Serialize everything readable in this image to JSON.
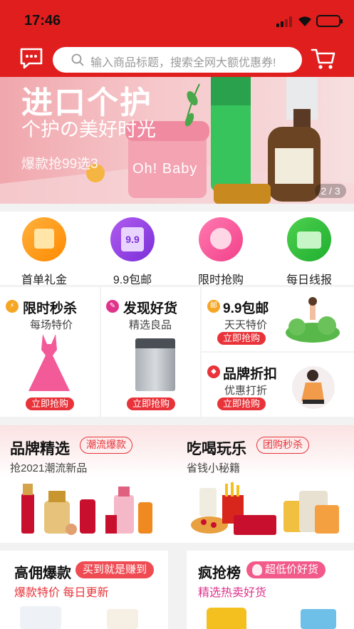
{
  "status": {
    "time": "17:46"
  },
  "search": {
    "placeholder": "输入商品标题，搜索全网大额优惠券!"
  },
  "banner": {
    "title": "进口个护",
    "subtitle": "个护の美好时光",
    "tag": "爆款抢99选3",
    "product_label": "Oh! Baby",
    "page": "2 / 3"
  },
  "categories": [
    {
      "label": "首单礼金"
    },
    {
      "label": "9.9包邮",
      "icon_text": "9.9"
    },
    {
      "label": "限时抢购"
    },
    {
      "label": "每日线报"
    }
  ],
  "deals": {
    "flash": {
      "title": "限时秒杀",
      "sub": "每场特价",
      "buy": "立即抢购"
    },
    "discover": {
      "title": "发现好货",
      "sub": "精选良品",
      "buy": "立即抢购"
    },
    "free": {
      "badge": "邮",
      "title": "9.9包邮",
      "sub": "天天特价",
      "buy": "立即抢购"
    },
    "brand": {
      "title": "品牌折扣",
      "sub": "优惠打折",
      "buy": "立即抢购"
    }
  },
  "sections": {
    "brand": {
      "title": "品牌精选",
      "pill": "潮流爆款",
      "sub": "抢2021潮流新品"
    },
    "food": {
      "title": "吃喝玩乐",
      "pill": "团购秒杀",
      "sub": "省钱小秘籍"
    },
    "commission": {
      "title": "高佣爆款",
      "pill": "买到就是赚到",
      "sub": "爆款特价 每日更新"
    },
    "rank": {
      "title": "疯抢榜",
      "pill": "超低价好货",
      "sub": "精选热卖好货"
    }
  },
  "colors": {
    "primary": "#e01e1e",
    "accent": "#e8333a"
  }
}
